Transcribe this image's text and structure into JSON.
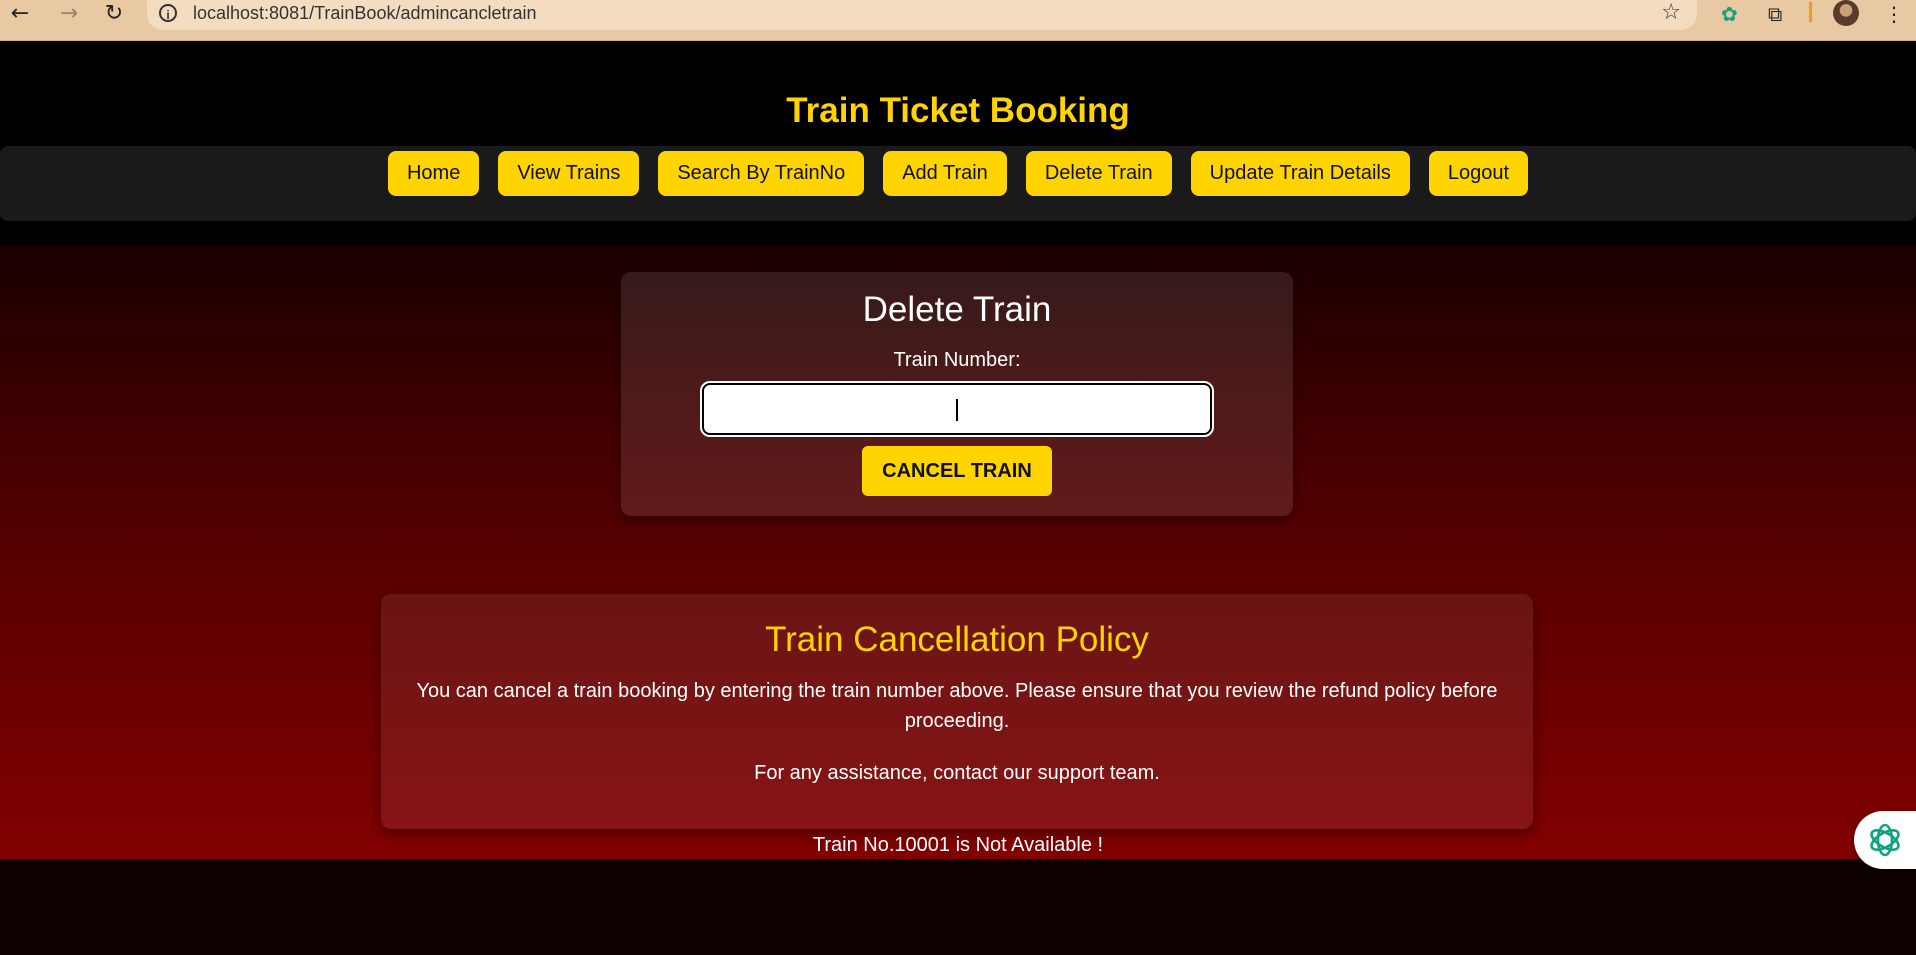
{
  "browser": {
    "url": "localhost:8081/TrainBook/admincancletrain",
    "back_icon": "←",
    "forward_icon": "→",
    "reload_icon": "↻",
    "info_icon": "i",
    "star_icon": "☆",
    "menu_icon": "⋮"
  },
  "header": {
    "title": "Train Ticket Booking"
  },
  "nav": {
    "items": [
      {
        "label": "Home"
      },
      {
        "label": "View Trains"
      },
      {
        "label": "Search By TrainNo"
      },
      {
        "label": "Add Train"
      },
      {
        "label": "Delete Train"
      },
      {
        "label": "Update Train Details"
      },
      {
        "label": "Logout"
      }
    ]
  },
  "form": {
    "heading": "Delete Train",
    "train_number_label": "Train Number:",
    "train_number_value": "",
    "submit_label": "CANCEL TRAIN"
  },
  "policy": {
    "title": "Train Cancellation Policy",
    "paragraph1": "You can cancel a train booking by entering the train number above. Please ensure that you review the refund policy before proceeding.",
    "paragraph2": "For any assistance, contact our support team."
  },
  "status": {
    "message": "Train No.10001 is Not Available !"
  },
  "colors": {
    "accent": "#ffd400",
    "header_bg": "#000000",
    "navbar_bg": "#1a1a1a",
    "main_gradient_top": "#1a0000",
    "main_gradient_bottom": "#820000"
  }
}
